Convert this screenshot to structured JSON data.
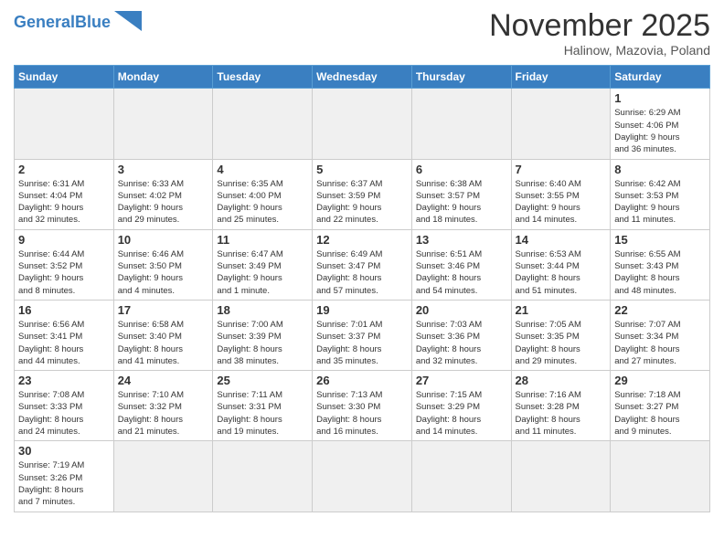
{
  "header": {
    "logo_general": "General",
    "logo_blue": "Blue",
    "month_title": "November 2025",
    "location": "Halinow, Mazovia, Poland"
  },
  "days_of_week": [
    "Sunday",
    "Monday",
    "Tuesday",
    "Wednesday",
    "Thursday",
    "Friday",
    "Saturday"
  ],
  "weeks": [
    [
      {
        "day": "",
        "info": ""
      },
      {
        "day": "",
        "info": ""
      },
      {
        "day": "",
        "info": ""
      },
      {
        "day": "",
        "info": ""
      },
      {
        "day": "",
        "info": ""
      },
      {
        "day": "",
        "info": ""
      },
      {
        "day": "1",
        "info": "Sunrise: 6:29 AM\nSunset: 4:06 PM\nDaylight: 9 hours\nand 36 minutes."
      }
    ],
    [
      {
        "day": "2",
        "info": "Sunrise: 6:31 AM\nSunset: 4:04 PM\nDaylight: 9 hours\nand 32 minutes."
      },
      {
        "day": "3",
        "info": "Sunrise: 6:33 AM\nSunset: 4:02 PM\nDaylight: 9 hours\nand 29 minutes."
      },
      {
        "day": "4",
        "info": "Sunrise: 6:35 AM\nSunset: 4:00 PM\nDaylight: 9 hours\nand 25 minutes."
      },
      {
        "day": "5",
        "info": "Sunrise: 6:37 AM\nSunset: 3:59 PM\nDaylight: 9 hours\nand 22 minutes."
      },
      {
        "day": "6",
        "info": "Sunrise: 6:38 AM\nSunset: 3:57 PM\nDaylight: 9 hours\nand 18 minutes."
      },
      {
        "day": "7",
        "info": "Sunrise: 6:40 AM\nSunset: 3:55 PM\nDaylight: 9 hours\nand 14 minutes."
      },
      {
        "day": "8",
        "info": "Sunrise: 6:42 AM\nSunset: 3:53 PM\nDaylight: 9 hours\nand 11 minutes."
      }
    ],
    [
      {
        "day": "9",
        "info": "Sunrise: 6:44 AM\nSunset: 3:52 PM\nDaylight: 9 hours\nand 8 minutes."
      },
      {
        "day": "10",
        "info": "Sunrise: 6:46 AM\nSunset: 3:50 PM\nDaylight: 9 hours\nand 4 minutes."
      },
      {
        "day": "11",
        "info": "Sunrise: 6:47 AM\nSunset: 3:49 PM\nDaylight: 9 hours\nand 1 minute."
      },
      {
        "day": "12",
        "info": "Sunrise: 6:49 AM\nSunset: 3:47 PM\nDaylight: 8 hours\nand 57 minutes."
      },
      {
        "day": "13",
        "info": "Sunrise: 6:51 AM\nSunset: 3:46 PM\nDaylight: 8 hours\nand 54 minutes."
      },
      {
        "day": "14",
        "info": "Sunrise: 6:53 AM\nSunset: 3:44 PM\nDaylight: 8 hours\nand 51 minutes."
      },
      {
        "day": "15",
        "info": "Sunrise: 6:55 AM\nSunset: 3:43 PM\nDaylight: 8 hours\nand 48 minutes."
      }
    ],
    [
      {
        "day": "16",
        "info": "Sunrise: 6:56 AM\nSunset: 3:41 PM\nDaylight: 8 hours\nand 44 minutes."
      },
      {
        "day": "17",
        "info": "Sunrise: 6:58 AM\nSunset: 3:40 PM\nDaylight: 8 hours\nand 41 minutes."
      },
      {
        "day": "18",
        "info": "Sunrise: 7:00 AM\nSunset: 3:39 PM\nDaylight: 8 hours\nand 38 minutes."
      },
      {
        "day": "19",
        "info": "Sunrise: 7:01 AM\nSunset: 3:37 PM\nDaylight: 8 hours\nand 35 minutes."
      },
      {
        "day": "20",
        "info": "Sunrise: 7:03 AM\nSunset: 3:36 PM\nDaylight: 8 hours\nand 32 minutes."
      },
      {
        "day": "21",
        "info": "Sunrise: 7:05 AM\nSunset: 3:35 PM\nDaylight: 8 hours\nand 29 minutes."
      },
      {
        "day": "22",
        "info": "Sunrise: 7:07 AM\nSunset: 3:34 PM\nDaylight: 8 hours\nand 27 minutes."
      }
    ],
    [
      {
        "day": "23",
        "info": "Sunrise: 7:08 AM\nSunset: 3:33 PM\nDaylight: 8 hours\nand 24 minutes."
      },
      {
        "day": "24",
        "info": "Sunrise: 7:10 AM\nSunset: 3:32 PM\nDaylight: 8 hours\nand 21 minutes."
      },
      {
        "day": "25",
        "info": "Sunrise: 7:11 AM\nSunset: 3:31 PM\nDaylight: 8 hours\nand 19 minutes."
      },
      {
        "day": "26",
        "info": "Sunrise: 7:13 AM\nSunset: 3:30 PM\nDaylight: 8 hours\nand 16 minutes."
      },
      {
        "day": "27",
        "info": "Sunrise: 7:15 AM\nSunset: 3:29 PM\nDaylight: 8 hours\nand 14 minutes."
      },
      {
        "day": "28",
        "info": "Sunrise: 7:16 AM\nSunset: 3:28 PM\nDaylight: 8 hours\nand 11 minutes."
      },
      {
        "day": "29",
        "info": "Sunrise: 7:18 AM\nSunset: 3:27 PM\nDaylight: 8 hours\nand 9 minutes."
      }
    ],
    [
      {
        "day": "30",
        "info": "Sunrise: 7:19 AM\nSunset: 3:26 PM\nDaylight: 8 hours\nand 7 minutes."
      },
      {
        "day": "",
        "info": ""
      },
      {
        "day": "",
        "info": ""
      },
      {
        "day": "",
        "info": ""
      },
      {
        "day": "",
        "info": ""
      },
      {
        "day": "",
        "info": ""
      },
      {
        "day": "",
        "info": ""
      }
    ]
  ]
}
